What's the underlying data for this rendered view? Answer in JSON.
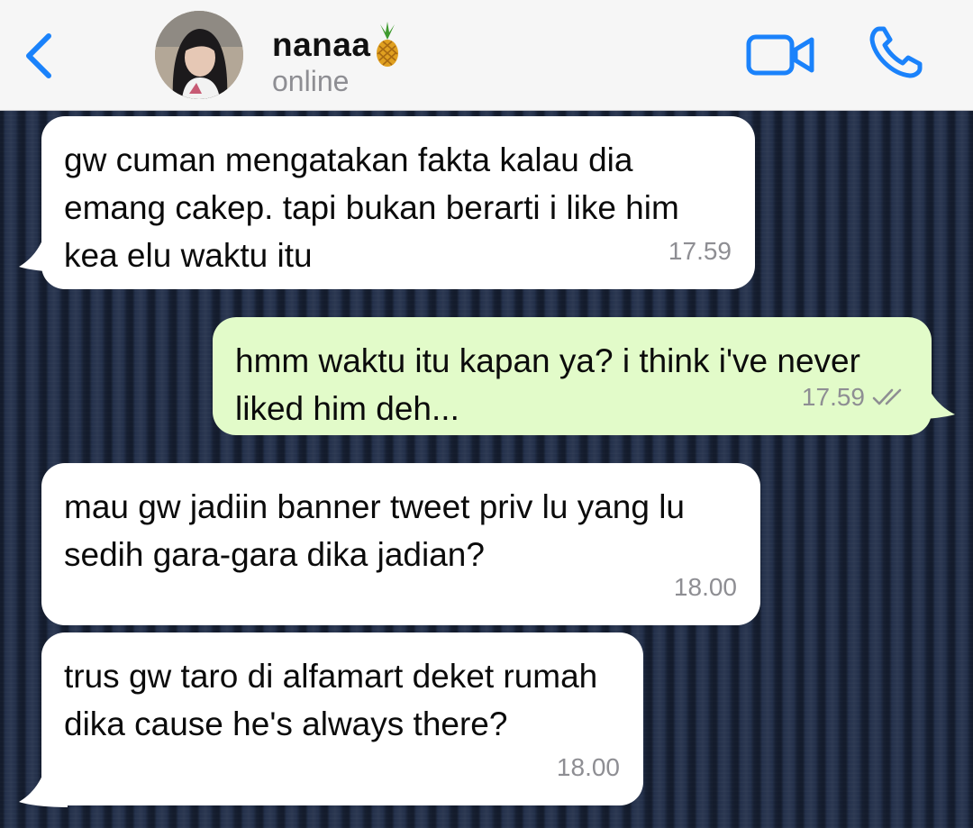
{
  "header": {
    "back_icon": "chevron-left-icon",
    "contact_name": "nanaa",
    "name_emoji": "pineapple-icon",
    "status": "online",
    "video_icon": "video-camera-icon",
    "call_icon": "phone-icon",
    "accent_color": "#1a82fb"
  },
  "messages": [
    {
      "direction": "incoming",
      "text": "gw cuman mengatakan fakta kalau dia emang cakep. tapi bukan berarti i like him kea elu waktu itu",
      "time": "17.59"
    },
    {
      "direction": "outgoing",
      "text": "hmm waktu itu kapan ya? i think i've never liked him deh...",
      "time": "17.59",
      "read_icon": "double-check-icon"
    },
    {
      "direction": "incoming",
      "text": "mau gw jadiin banner tweet priv lu yang lu sedih gara-gara dika jadian?",
      "time": "18.00"
    },
    {
      "direction": "incoming",
      "text": "trus gw taro di alfamart deket rumah dika cause he's always there?",
      "time": "18.00"
    }
  ],
  "colors": {
    "incoming_bubble": "#ffffff",
    "outgoing_bubble": "#e2fbc9",
    "header_bg": "#f6f6f6",
    "chat_wallpaper": "#1f2c47"
  }
}
